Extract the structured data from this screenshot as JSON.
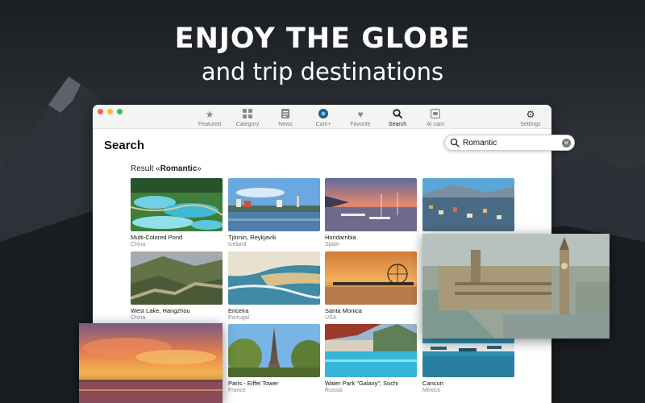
{
  "hero": {
    "title": "ENJOY THE GLOBE",
    "subtitle": "and trip destinations"
  },
  "toolbar": {
    "items": [
      {
        "label": "Featured",
        "icon": "star-icon"
      },
      {
        "label": "Category",
        "icon": "grid-icon"
      },
      {
        "label": "News",
        "icon": "news-icon"
      },
      {
        "label": "Cam+",
        "icon": "camera-plus-icon"
      },
      {
        "label": "Favorite",
        "icon": "heart-icon"
      },
      {
        "label": "Search",
        "icon": "search-icon",
        "active": true
      },
      {
        "label": "AI cam",
        "icon": "ai-cam-icon"
      },
      {
        "label": "Settings",
        "icon": "gear-icon"
      }
    ]
  },
  "page": {
    "title": "Search",
    "result_prefix": "Result «",
    "result_query": "Romantic",
    "result_suffix": "»"
  },
  "search": {
    "value": "Romantic",
    "placeholder": "Search"
  },
  "results": [
    {
      "name": "Multi-Colored Pond",
      "country": "China"
    },
    {
      "name": "Tjörnin, Reykjavík",
      "country": "Iceland"
    },
    {
      "name": "Hondarribia",
      "country": "Spain"
    },
    {
      "name": "West Lake, Hangzhou",
      "country": "China"
    },
    {
      "name": "Ericeira",
      "country": "Portugal"
    },
    {
      "name": "Santa Monica",
      "country": "USA"
    },
    {
      "name": "Paris - Eiffel Tower",
      "country": "France"
    },
    {
      "name": "Water Park \"Galaxy\", Sochi",
      "country": "Russia"
    },
    {
      "name": "Cancun",
      "country": "Mexico"
    }
  ],
  "colors": {
    "active": "#222222",
    "inactive": "#8a8a8a",
    "close": "#ff5f57",
    "minimize": "#febc2e",
    "zoom": "#28c840"
  }
}
